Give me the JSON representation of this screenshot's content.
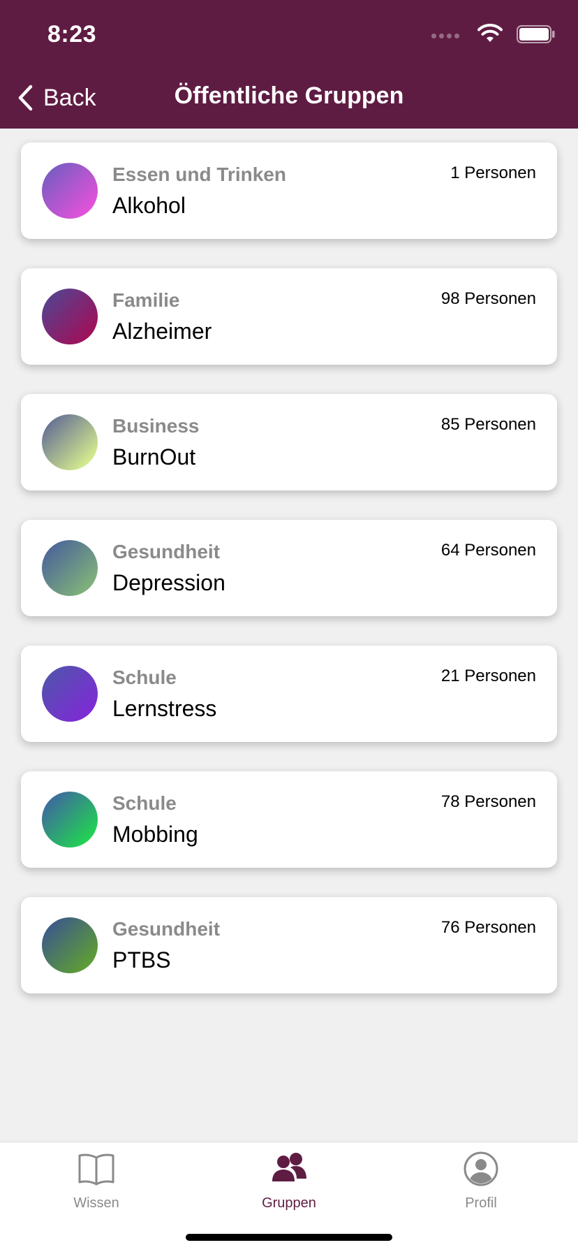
{
  "status_bar": {
    "time": "8:23",
    "signal_icon": "signal-dots-icon",
    "wifi_icon": "wifi-icon",
    "battery_icon": "battery-icon"
  },
  "nav": {
    "back_label": "Back",
    "back_icon": "chevron-left-icon",
    "title": "Öffentliche Gruppen"
  },
  "groups": [
    {
      "category": "Essen und Trinken",
      "name": "Alkohol",
      "members": "1 Personen",
      "colors": [
        "#7d5cc4",
        "#e352d9"
      ]
    },
    {
      "category": "Familie",
      "name": "Alzheimer",
      "members": "98 Personen",
      "colors": [
        "#5a3f8c",
        "#a0105a"
      ]
    },
    {
      "category": "Business",
      "name": "BurnOut",
      "members": "85 Personen",
      "colors": [
        "#6a7594",
        "#d6ec8e"
      ]
    },
    {
      "category": "Gesundheit",
      "name": "Depression",
      "members": "64 Personen",
      "colors": [
        "#4f6898",
        "#7fb27a"
      ]
    },
    {
      "category": "Schule",
      "name": "Lernstress",
      "members": "21 Personen",
      "colors": [
        "#5550b0",
        "#7e2bd4"
      ]
    },
    {
      "category": "Schule",
      "name": "Mobbing",
      "members": "78 Personen",
      "colors": [
        "#3d6c9c",
        "#22d352"
      ]
    },
    {
      "category": "Gesundheit",
      "name": "PTBS",
      "members": "76 Personen",
      "colors": [
        "#3e5c86",
        "#5e9e34"
      ]
    }
  ],
  "tabbar": {
    "tabs": [
      {
        "label": "Wissen",
        "icon": "book-icon",
        "active": false
      },
      {
        "label": "Gruppen",
        "icon": "group-icon",
        "active": true
      },
      {
        "label": "Profil",
        "icon": "profile-icon",
        "active": false
      }
    ]
  },
  "colors": {
    "brand": "#5f1c43",
    "background": "#f0f0f0",
    "inactive": "#8a8a8a"
  }
}
